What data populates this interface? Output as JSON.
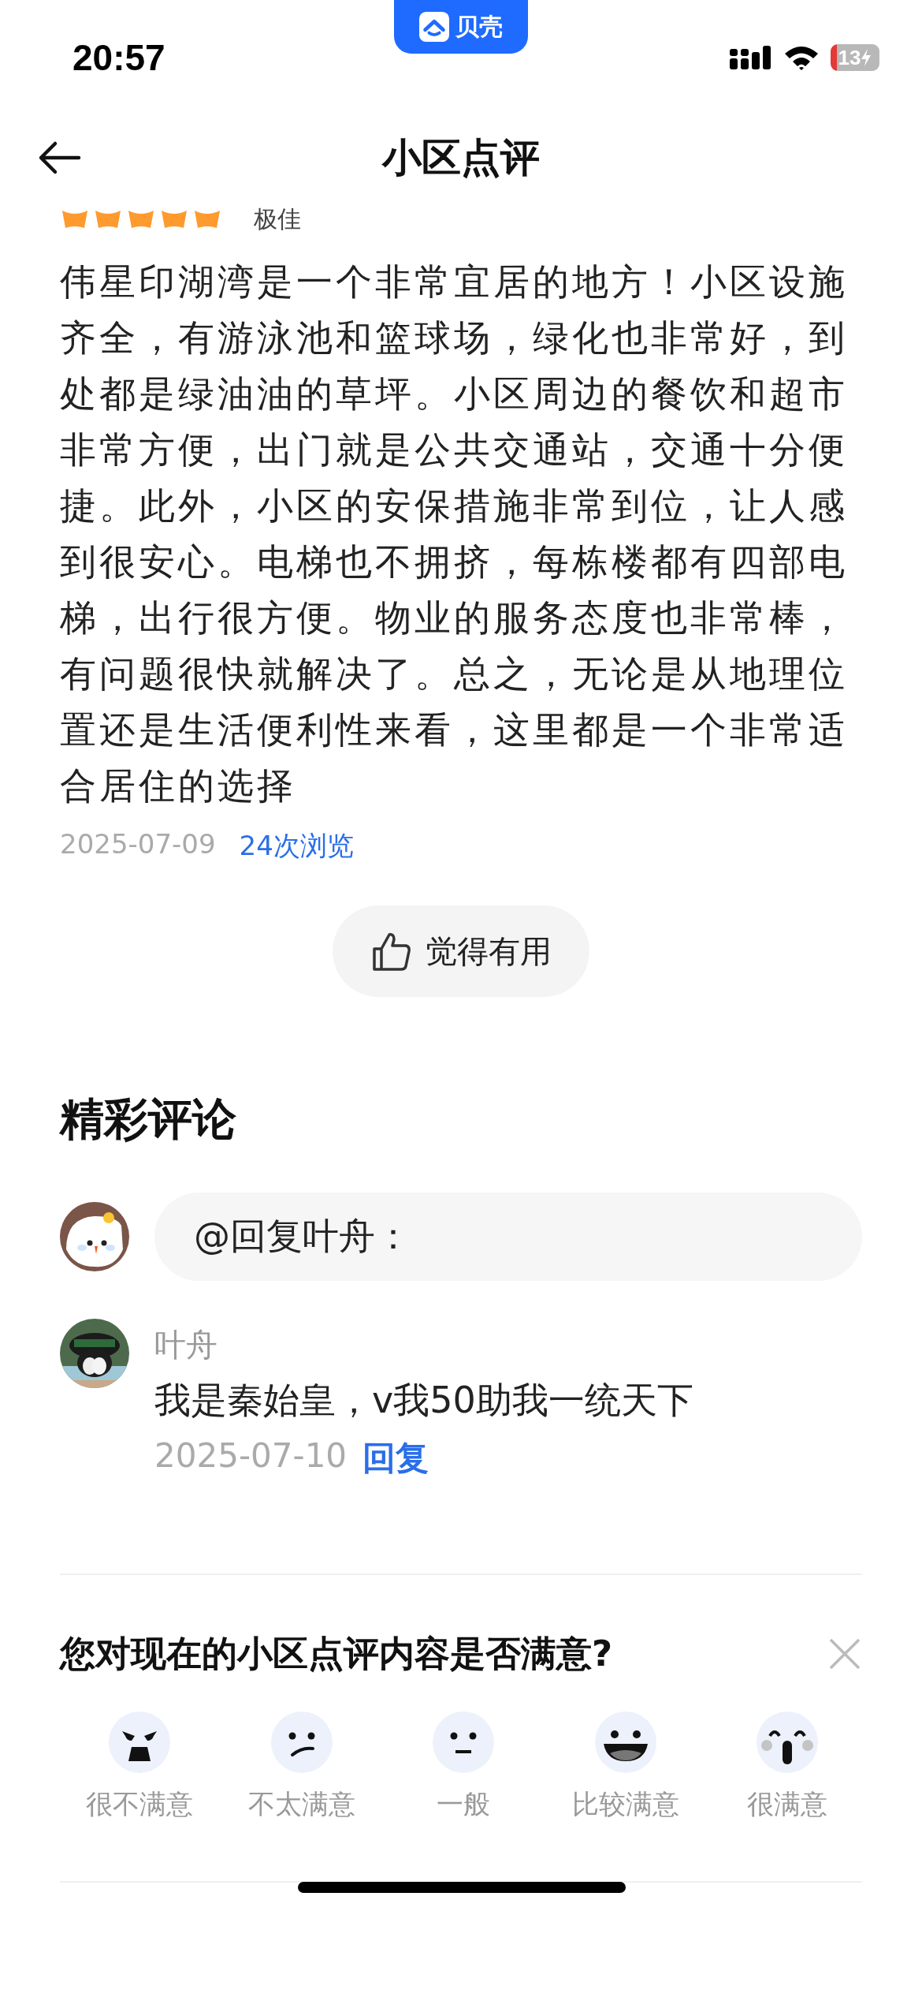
{
  "status_bar": {
    "time": "20:57",
    "app_badge": "贝壳",
    "battery": "13"
  },
  "header": {
    "title": "小区点评"
  },
  "review": {
    "stars": 5,
    "rating_label": "极佳",
    "text": "伟星印湖湾是一个非常宜居的地方！小区设施齐全，有游泳池和篮球场，绿化也非常好，到处都是绿油油的草坪。小区周边的餐饮和超市非常方便，出门就是公共交通站，交通十分便捷。此外，小区的安保措施非常到位，让人感到很安心。电梯也不拥挤，每栋楼都有四部电梯，出行很方便。物业的服务态度也非常棒，有问题很快就解决了。总之，无论是从地理位置还是生活便利性来看，这里都是一个非常适合居住的选择",
    "date": "2025-07-09",
    "views": "24次浏览",
    "useful_button": "觉得有用"
  },
  "comments_section": {
    "title": "精彩评论",
    "reply_field": {
      "value": "@回复叶舟："
    },
    "comments": [
      {
        "author": "叶舟",
        "text": "我是秦始皇，v我50助我一统天下",
        "date": "2025-07-10",
        "reply": "回复"
      }
    ]
  },
  "survey": {
    "question": "您对现在的小区点评内容是否满意?",
    "options": [
      {
        "kind": "angry",
        "label": "很不满意"
      },
      {
        "kind": "frown",
        "label": "不太满意"
      },
      {
        "kind": "neutral",
        "label": "一般"
      },
      {
        "kind": "grin",
        "label": "比较满意"
      },
      {
        "kind": "wow",
        "label": "很满意"
      }
    ]
  }
}
